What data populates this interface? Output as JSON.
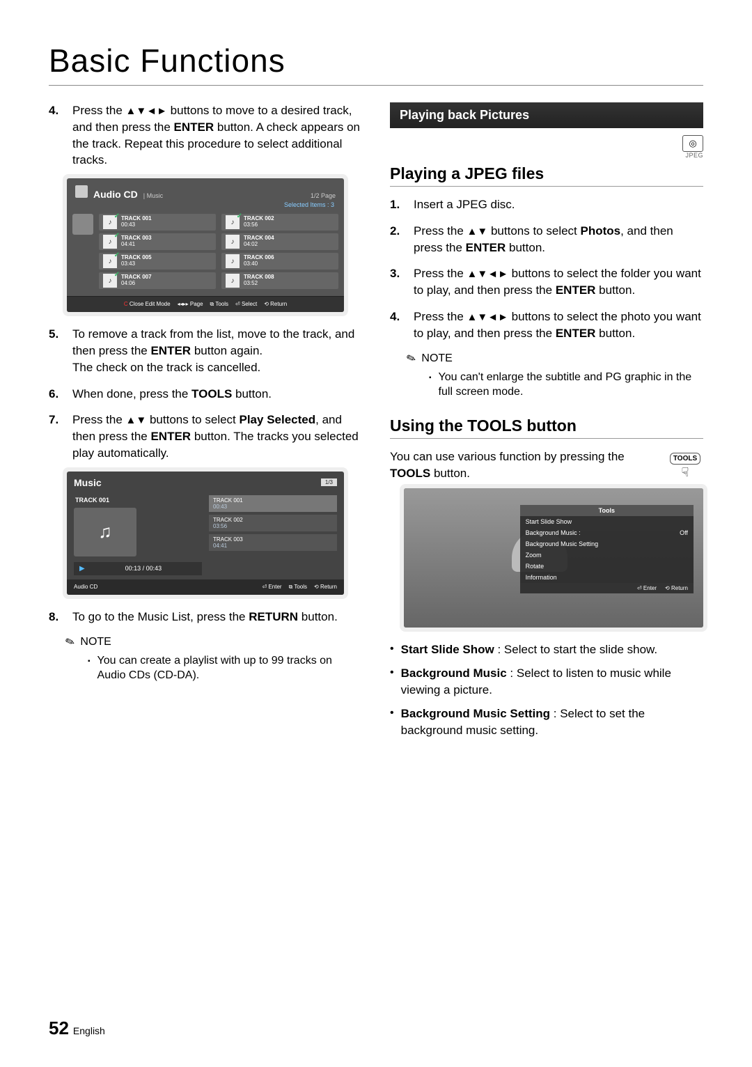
{
  "title": "Basic Functions",
  "left": {
    "step4_pre": "Press the ",
    "step4_post": " buttons to move to a desired track, and then press the ",
    "enter": "ENTER",
    "step4_tail": " button. A check appears on the track. Repeat this procedure to select additional tracks.",
    "step5a": "To remove a track from the list, move to the track, and then press the ",
    "step5b": " button again.",
    "step5c": "The check on the track is cancelled.",
    "step6a": "When done, press the ",
    "tools": "TOOLS",
    "step6b": " button.",
    "step7a": "Press the ",
    "step7b": " buttons to select ",
    "play_selected": "Play Selected",
    "step7c": ", and then press the ",
    "step7d": " button. The tracks you selected play automatically.",
    "step8a": "To go to the Music List, press the ",
    "return": "RETURN",
    "step8b": " button.",
    "note_label": "NOTE",
    "note1": "You can create a playlist with up to 99 tracks on Audio CDs (CD-DA)."
  },
  "audio_scr": {
    "title": "Audio CD",
    "subtitle": "| Music",
    "page": "1/2 Page",
    "selected": "Selected Items : 3",
    "tracks": [
      {
        "n": "TRACK 001",
        "d": "00:43"
      },
      {
        "n": "TRACK 002",
        "d": "03:56"
      },
      {
        "n": "TRACK 003",
        "d": "04:41"
      },
      {
        "n": "TRACK 004",
        "d": "04:02"
      },
      {
        "n": "TRACK 005",
        "d": "03:43"
      },
      {
        "n": "TRACK 006",
        "d": "03:40"
      },
      {
        "n": "TRACK 007",
        "d": "04:06"
      },
      {
        "n": "TRACK 008",
        "d": "03:52"
      }
    ],
    "footer": {
      "close": "Close Edit Mode",
      "page": "Page",
      "tools": "Tools",
      "select": "Select",
      "return": "Return"
    }
  },
  "music_scr": {
    "title": "Music",
    "page": "1/3",
    "current": "TRACK 001",
    "time": "00:13 / 00:43",
    "list": [
      {
        "n": "TRACK 001",
        "d": "00:43"
      },
      {
        "n": "TRACK 002",
        "d": "03:56"
      },
      {
        "n": "TRACK 003",
        "d": "04:41"
      }
    ],
    "info": "Audio CD",
    "footer": {
      "enter": "Enter",
      "tools": "Tools",
      "return": "Return"
    }
  },
  "right": {
    "section_bar": "Playing back Pictures",
    "jpeg_badge": "JPEG",
    "h_jpeg": "Playing a JPEG files",
    "r1": "Insert a JPEG disc.",
    "r2a": "Press the ",
    "r2b": " buttons to select ",
    "photos": "Photos",
    "r2c": ", and then press the ",
    "r2d": " button.",
    "r3a": "Press the ",
    "r3b": " buttons to select the folder you want to play, and then press the ",
    "r3c": " button.",
    "r4a": "Press the ",
    "r4b": " buttons to select the photo you want to play, and then press the ",
    "r4c": " button.",
    "note_label": "NOTE",
    "note1": "You can't enlarge the subtitle and PG graphic in the full screen mode.",
    "h_tools": "Using the TOOLS button",
    "tools_intro_a": "You can use various function by pressing the ",
    "tools_word": "TOOLS",
    "tools_intro_b": " button.",
    "tools_btn": "TOOLS",
    "menu": {
      "title": "Tools",
      "items": [
        {
          "l": "Start Slide Show",
          "v": ""
        },
        {
          "l": "Background Music   :",
          "v": "Off"
        },
        {
          "l": "Background Music Setting",
          "v": ""
        },
        {
          "l": "Zoom",
          "v": ""
        },
        {
          "l": "Rotate",
          "v": ""
        },
        {
          "l": "Information",
          "v": ""
        }
      ],
      "footer": {
        "enter": "Enter",
        "return": "Return"
      }
    },
    "bullets": [
      {
        "b": "Start Slide Show",
        "t": " : Select to start the slide show."
      },
      {
        "b": "Background Music",
        "t": " : Select to listen to music while viewing a picture."
      },
      {
        "b": "Background Music Setting",
        "t": " : Select to set the background music setting."
      }
    ]
  },
  "footer": {
    "page": "52",
    "lang": "English"
  }
}
